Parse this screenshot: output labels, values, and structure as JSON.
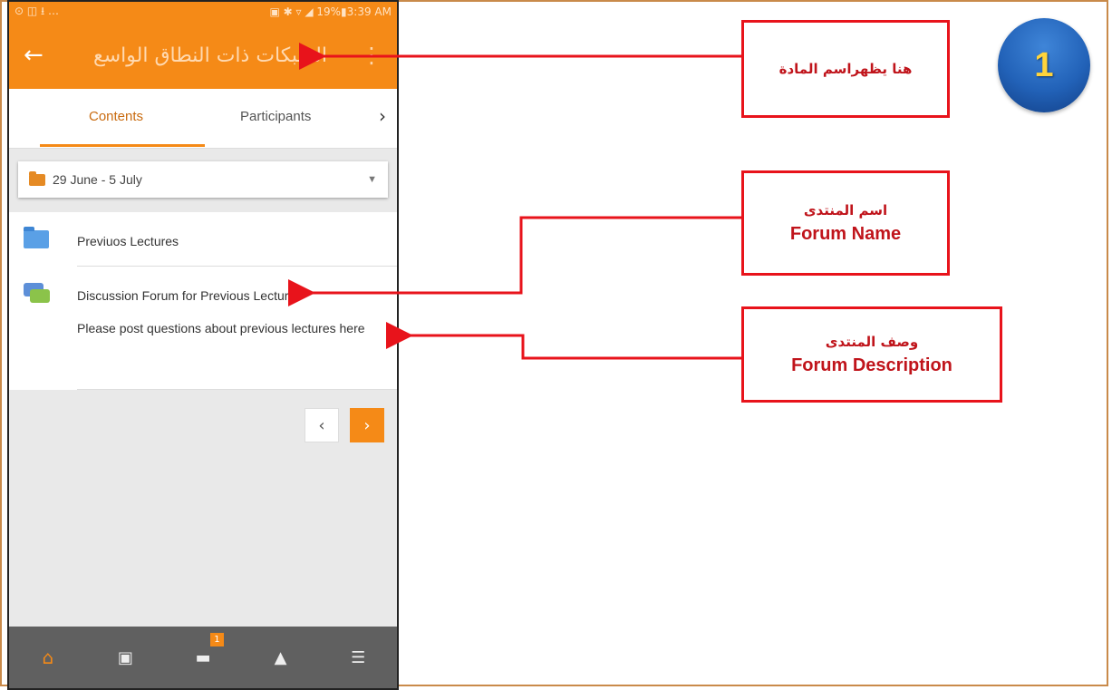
{
  "status_bar": {
    "left": "⊙ ◫ ⭳ …",
    "right": "▣ ✱ ▿ ◢ 19%▮3:39 AM"
  },
  "app_bar": {
    "back_icon": "←",
    "title": "الشبكات ذات النطاق الواسع",
    "menu_icon": "⋮"
  },
  "tabs": {
    "contents": "Contents",
    "participants": "Participants",
    "next_icon": "›"
  },
  "section_selector": {
    "value": "29 June - 5 July"
  },
  "items": [
    {
      "icon": "folder-icon",
      "title": "Previuos Lectures"
    },
    {
      "icon": "forum-icon",
      "title": "Discussion Forum for Previous Lectures",
      "description": "Please post questions about previous lectures here"
    }
  ],
  "pager": {
    "prev": "‹",
    "next": "›"
  },
  "bottom_nav": {
    "messages_badge": "1"
  },
  "annotations": {
    "course_name": "هنا يظهراسم المادة",
    "forum_name_ar": "اسم المنتدى",
    "forum_name_en": "Forum Name",
    "forum_desc_ar": "وصف المنتدى",
    "forum_desc_en": "Forum Description",
    "step_number": "1"
  },
  "colors": {
    "accent": "#f58a17",
    "callout_border": "#e8131b",
    "badge_blue": "#2262b8"
  }
}
